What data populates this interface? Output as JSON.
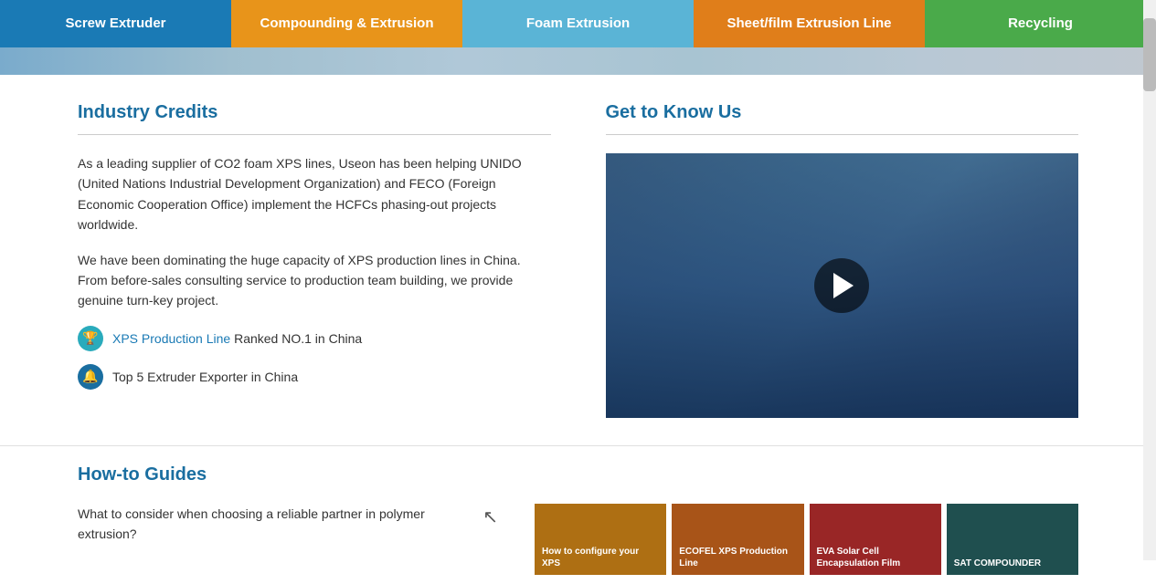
{
  "nav": {
    "tabs": [
      {
        "id": "screw-extruder",
        "label": "Screw Extruder",
        "colorClass": "blue"
      },
      {
        "id": "compounding-extrusion",
        "label": "Compounding & Extrusion",
        "colorClass": "orange"
      },
      {
        "id": "foam-extrusion",
        "label": "Foam Extrusion",
        "colorClass": "light-blue"
      },
      {
        "id": "sheet-film",
        "label": "Sheet/film Extrusion Line",
        "colorClass": "dark-orange"
      },
      {
        "id": "recycling",
        "label": "Recycling",
        "colorClass": "green"
      }
    ]
  },
  "industry_credits": {
    "title": "Industry Credits",
    "paragraph1": "As a leading supplier of CO2 foam XPS lines, Useon has been helping UNIDO (United Nations Industrial Development Organization) and FECO (Foreign Economic Cooperation Office) implement the HCFCs phasing-out projects worldwide.",
    "paragraph2": "We have been dominating the huge capacity of XPS production lines in China. From before-sales consulting service to production team building, we provide genuine turn-key project.",
    "badge1_link": "XPS Production Line",
    "badge1_text": " Ranked NO.1 in China",
    "badge2_text": "Top 5 Extruder Exporter in China"
  },
  "get_to_know_us": {
    "title": "Get to Know Us"
  },
  "how_to_guides": {
    "title": "How-to Guides",
    "text1": "What to consider when choosing a reliable partner in polymer extrusion?",
    "cards": [
      {
        "id": "how-configure",
        "label": "How to configure your XPS",
        "colorClass": "orange"
      },
      {
        "id": "ecofel-xps",
        "label": "ECOFEL XPS Production Line",
        "colorClass": "orange2"
      },
      {
        "id": "eva-solar",
        "label": "EVA Solar Cell Encapsulation Film",
        "colorClass": "red"
      },
      {
        "id": "sat-compounder",
        "label": "SAT COMPOUNDER",
        "colorClass": "dark-teal"
      }
    ]
  }
}
